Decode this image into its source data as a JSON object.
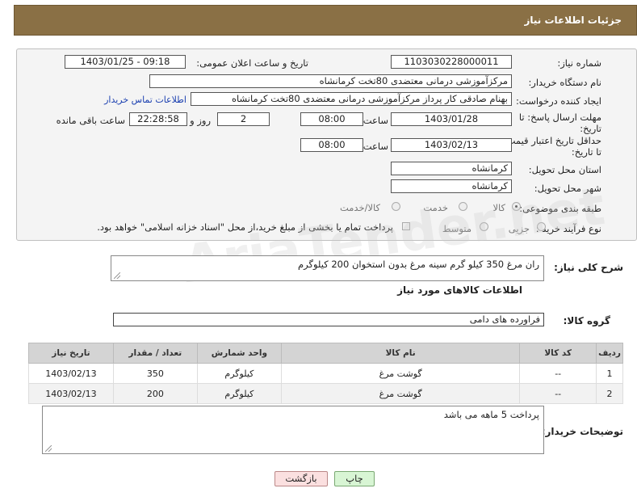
{
  "header": {
    "title": "جزئیات اطلاعات نیاز"
  },
  "form": {
    "need_number_label": "شماره نیاز:",
    "need_number": "1103030228000011",
    "announce_label": "تاریخ و ساعت اعلان عمومی:",
    "announce_value": "1403/01/25 - 09:18",
    "buyer_org_label": "نام دستگاه خریدار:",
    "buyer_org": "مرکزآموزشی درمانی معتضدی 80تخت کرمانشاه",
    "requester_label": "ایجاد کننده درخواست:",
    "requester": "بهنام صادقی کار پرداز مرکزآموزشی درمانی معتضدی 80تخت کرمانشاه",
    "contact_link": "اطلاعات تماس خریدار",
    "reply_deadline_label": "مهلت ارسال پاسخ: تا تاریخ:",
    "reply_date": "1403/01/28",
    "time_label": "ساعت",
    "reply_time": "08:00",
    "days_value": "2",
    "days_label": "روز و",
    "remaining_time": "22:28:58",
    "remaining_label": "ساعت باقی مانده",
    "price_deadline_label": "حداقل تاریخ اعتبار قیمت: تا تاریخ:",
    "price_date": "1403/02/13",
    "price_time_label": "ساعت",
    "price_time": "08:00",
    "province_label": "استان محل تحویل:",
    "province": "کرمانشاه",
    "city_label": "شهر محل تحویل:",
    "city": "کرمانشاه",
    "category_label": "طبقه بندی موضوعی:",
    "category_options": [
      "کالا",
      "خدمت",
      "کالا/خدمت"
    ],
    "process_label": "نوع فرآیند خرید :",
    "process_options": [
      "جزیی",
      "متوسط"
    ],
    "payment_note": "پرداخت تمام یا بخشی از مبلغ خرید،از محل \"اسناد خزانه اسلامی\" خواهد بود."
  },
  "description": {
    "label": "شرح کلی نیاز:",
    "text": "ران مرغ 350 کیلو گرم  سینه مرغ بدون استخوان 200 کیلوگرم"
  },
  "goods_section": {
    "title": "اطلاعات کالاهای مورد نیاز",
    "group_label": "گروه کالا:",
    "group_value": "فراورده های دامی"
  },
  "table": {
    "headers": [
      "ردیف",
      "کد کالا",
      "نام کالا",
      "واحد شمارش",
      "تعداد / مقدار",
      "تاریخ نیاز"
    ],
    "rows": [
      [
        "1",
        "--",
        "گوشت مرغ",
        "کیلوگرم",
        "350",
        "1403/02/13"
      ],
      [
        "2",
        "--",
        "گوشت مرغ",
        "کیلوگرم",
        "200",
        "1403/02/13"
      ]
    ]
  },
  "buyer_notes": {
    "label": "توضیحات خریدار:",
    "text": "پرداخت 5 ماهه می باشد"
  },
  "buttons": {
    "print": "چاپ",
    "back": "بازگشت"
  }
}
